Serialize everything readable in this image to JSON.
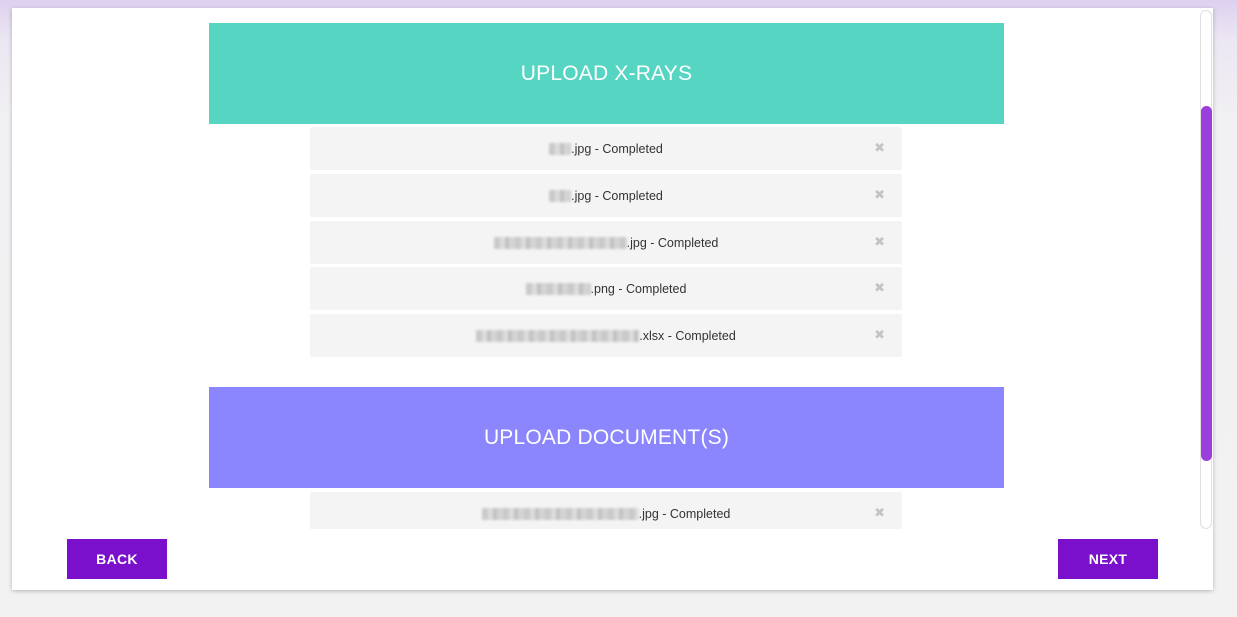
{
  "xrays_section": {
    "title": "UPLOAD X-RAYS",
    "files": [
      {
        "suffix": ".jpg - Completed"
      },
      {
        "suffix": ".jpg - Completed"
      },
      {
        "suffix": ".jpg - Completed"
      },
      {
        "suffix": ".png - Completed"
      },
      {
        "suffix": ".xlsx - Completed"
      }
    ]
  },
  "documents_section": {
    "title": "UPLOAD DOCUMENT(S)",
    "files": [
      {
        "suffix": ".jpg - Completed"
      }
    ]
  },
  "remove_icon": "✖",
  "footer": {
    "back_label": "BACK",
    "next_label": "NEXT"
  },
  "colors": {
    "xrays_header": "#56d5c3",
    "documents_header": "#8b86fd",
    "button": "#7a10cc",
    "scrollbar_thumb": "#9a3fdb"
  }
}
